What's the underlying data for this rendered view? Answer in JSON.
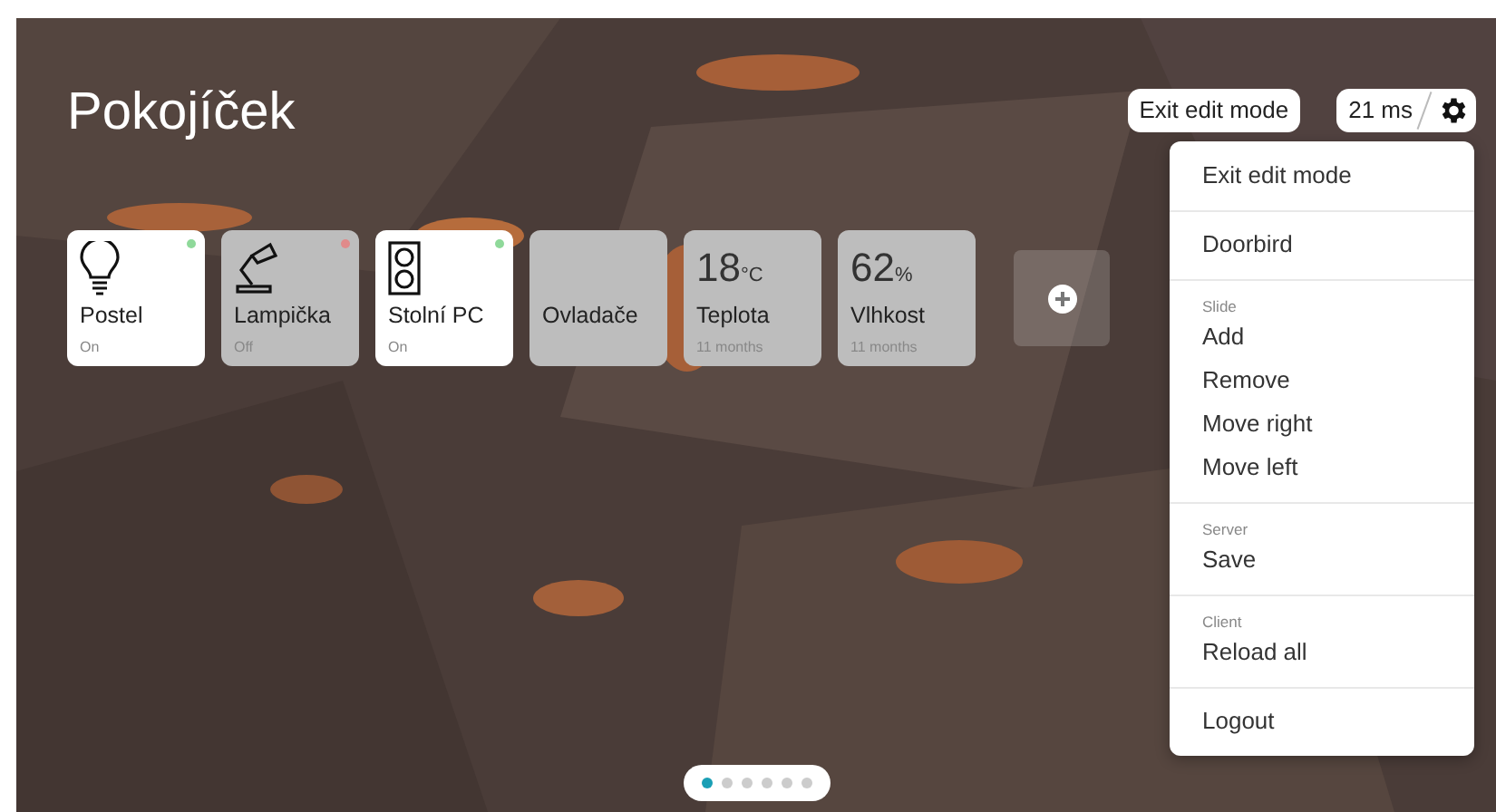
{
  "title": "Pokojíček",
  "header": {
    "edit_button": "Exit edit mode",
    "latency": "21 ms"
  },
  "tiles": [
    {
      "kind": "bulb",
      "name": "Postel",
      "state": "On",
      "on": true,
      "color": "#8fd99a"
    },
    {
      "kind": "lamp",
      "name": "Lampička",
      "state": "Off",
      "on": false,
      "color": "#e08a8a"
    },
    {
      "kind": "socket",
      "name": "Stolní PC",
      "state": "On",
      "on": true,
      "color": "#8fd99a"
    },
    {
      "kind": "group",
      "name": "Ovladače"
    },
    {
      "kind": "sensor",
      "value": "18",
      "unit": "°C",
      "name": "Teplota",
      "time": "11 months"
    },
    {
      "kind": "sensor",
      "value": "62",
      "unit": "%",
      "name": "Vlhkost",
      "time": "11 months"
    }
  ],
  "menu": [
    {
      "items": [
        "Exit edit mode"
      ]
    },
    {
      "items": [
        "Doorbird"
      ]
    },
    {
      "header": "Slide",
      "items": [
        "Add",
        "Remove",
        "Move right",
        "Move left"
      ]
    },
    {
      "header": "Server",
      "items": [
        "Save"
      ]
    },
    {
      "header": "Client",
      "items": [
        "Reload all"
      ]
    },
    {
      "items": [
        "Logout"
      ]
    }
  ],
  "pages": [
    {
      "selected": true
    },
    {
      "selected": false
    },
    {
      "selected": false
    },
    {
      "selected": false
    },
    {
      "selected": false
    },
    {
      "selected": false
    }
  ]
}
